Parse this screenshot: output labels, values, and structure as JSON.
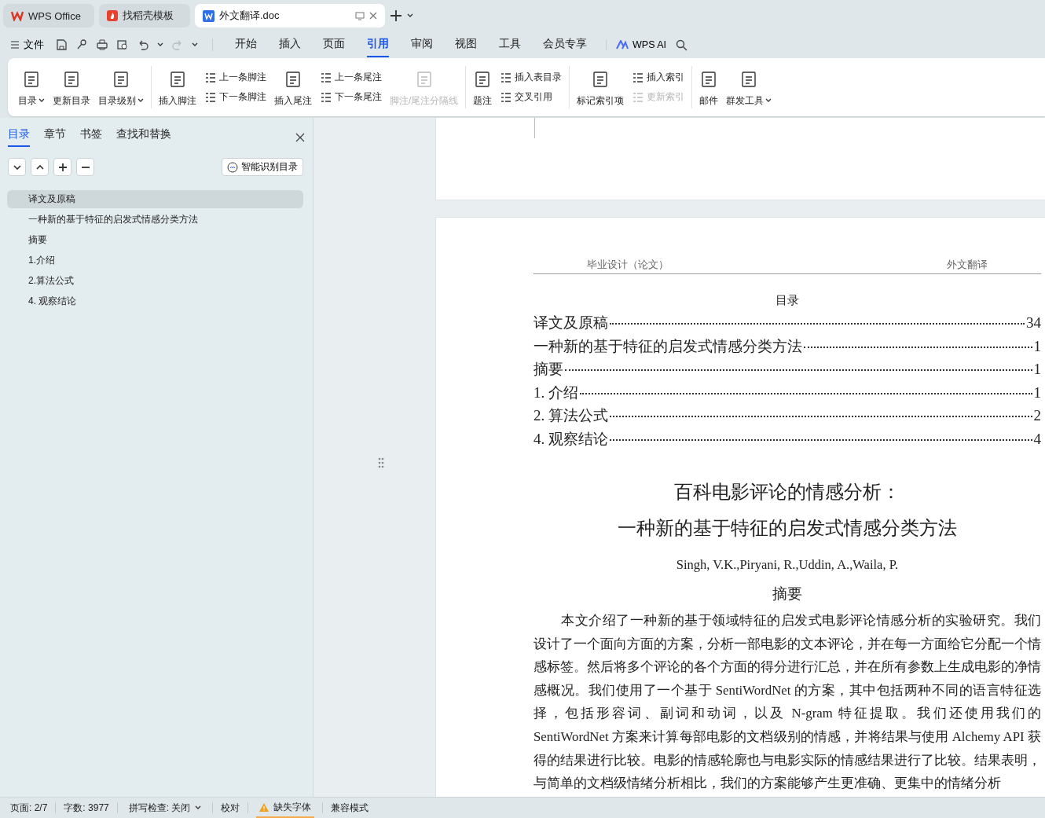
{
  "tabs": [
    {
      "label": "WPS Office",
      "selected": false
    },
    {
      "label": "找稻壳模板",
      "selected": false
    },
    {
      "label": "外文翻译.doc",
      "selected": true
    }
  ],
  "menu": {
    "file": "文件",
    "tabs": [
      {
        "label": "开始",
        "selected": false
      },
      {
        "label": "插入",
        "selected": false
      },
      {
        "label": "页面",
        "selected": false
      },
      {
        "label": "引用",
        "selected": true
      },
      {
        "label": "审阅",
        "selected": false
      },
      {
        "label": "视图",
        "selected": false
      },
      {
        "label": "工具",
        "selected": false
      },
      {
        "label": "会员专享",
        "selected": false
      }
    ],
    "ai": "WPS AI"
  },
  "ribbon": {
    "groups": [
      {
        "columns": [
          {
            "kind": "large",
            "label": "目录",
            "dropdown": true,
            "disabled": false
          },
          {
            "kind": "large",
            "label": "更新目录",
            "dropdown": false,
            "disabled": false
          },
          {
            "kind": "large",
            "label": "目录级别",
            "dropdown": true,
            "disabled": false
          }
        ]
      },
      {
        "columns": [
          {
            "kind": "large",
            "label": "插入脚注",
            "dropdown": false,
            "disabled": false
          },
          {
            "kind": "stack",
            "items": [
              {
                "label": "上一条脚注",
                "disabled": false
              },
              {
                "label": "下一条脚注",
                "disabled": false
              }
            ]
          },
          {
            "kind": "large",
            "label": "插入尾注",
            "dropdown": false,
            "disabled": false
          },
          {
            "kind": "stack",
            "items": [
              {
                "label": "上一条尾注",
                "disabled": false
              },
              {
                "label": "下一条尾注",
                "disabled": false
              }
            ]
          },
          {
            "kind": "large",
            "label": "脚注/尾注分隔线",
            "dropdown": false,
            "disabled": true
          }
        ]
      },
      {
        "columns": [
          {
            "kind": "large",
            "label": "题注",
            "dropdown": false,
            "disabled": false
          },
          {
            "kind": "stack",
            "items": [
              {
                "label": "插入表目录",
                "disabled": false
              },
              {
                "label": "交叉引用",
                "disabled": false
              }
            ]
          }
        ]
      },
      {
        "columns": [
          {
            "kind": "large",
            "label": "标记索引项",
            "dropdown": false,
            "disabled": false
          },
          {
            "kind": "stack",
            "items": [
              {
                "label": "插入索引",
                "disabled": false
              },
              {
                "label": "更新索引",
                "disabled": true
              }
            ]
          }
        ]
      },
      {
        "columns": [
          {
            "kind": "large",
            "label": "邮件",
            "dropdown": false,
            "disabled": false
          },
          {
            "kind": "large",
            "label": "群发工具",
            "dropdown": true,
            "disabled": false
          }
        ]
      }
    ]
  },
  "nav": {
    "tabs": [
      {
        "label": "目录",
        "selected": true
      },
      {
        "label": "章节",
        "selected": false
      },
      {
        "label": "书签",
        "selected": false
      },
      {
        "label": "查找和替换",
        "selected": false
      }
    ],
    "smart_button": "智能识别目录",
    "items": [
      {
        "label": "译文及原稿",
        "selected": true
      },
      {
        "label": "一种新的基于特征的启发式情感分类方法",
        "selected": false
      },
      {
        "label": "摘要",
        "selected": false
      },
      {
        "label": "1.介绍",
        "selected": false
      },
      {
        "label": "2.算法公式",
        "selected": false
      },
      {
        "label": "4.  观察结论",
        "selected": false
      }
    ]
  },
  "document": {
    "header_left": "毕业设计（论文）",
    "header_right": "外文翻译",
    "toc_title": "目录",
    "toc": [
      {
        "title": "译文及原稿",
        "page": "34"
      },
      {
        "title": "一种新的基于特征的启发式情感分类方法",
        "page": "1"
      },
      {
        "title": "摘要",
        "page": "1"
      },
      {
        "title": "1.  介绍",
        "page": "1"
      },
      {
        "title": "2.  算法公式",
        "page": "2"
      },
      {
        "title": "4.   观察结论",
        "page": "4"
      }
    ],
    "title_lines": [
      "百科电影评论的情感分析：",
      "一种新的基于特征的启发式情感分类方法"
    ],
    "authors": "Singh, V.K.,Piryani, R.,Uddin, A.,Waila, P.",
    "abstract_heading": "摘要",
    "abstract": "本文介绍了一种新的基于领域特征的启发式电影评论情感分析的实验研究。我们设计了一个面向方面的方案，分析一部电影的文本评论，并在每一方面给它分配一个情感标签。然后将多个评论的各个方面的得分进行汇总，并在所有参数上生成电影的净情感概况。我们使用了一个基于 SentiWordNet 的方案，其中包括两种不同的语言特征选择，包括形容词、副词和动词，以及 N-gram 特征提取。我们还使用我们的 SentiWordNet 方案来计算每部电影的文档级别的情感，并将结果与使用 Alchemy API 获得的结果进行比较。电影的情感轮廓也与电影实际的情感结果进行了比较。结果表明，与简单的文档级情绪分析相比，我们的方案能够产生更准确、更集中的情绪分析"
  },
  "status_bar": [
    {
      "kind": "text",
      "label": "页面: 2/7"
    },
    {
      "kind": "text",
      "label": "字数: 3977"
    },
    {
      "kind": "dropdown",
      "label": "拼写检查: 关闭"
    },
    {
      "kind": "text",
      "label": "校对"
    },
    {
      "kind": "warning",
      "label": "缺失字体"
    },
    {
      "kind": "text",
      "label": "兼容模式"
    }
  ]
}
